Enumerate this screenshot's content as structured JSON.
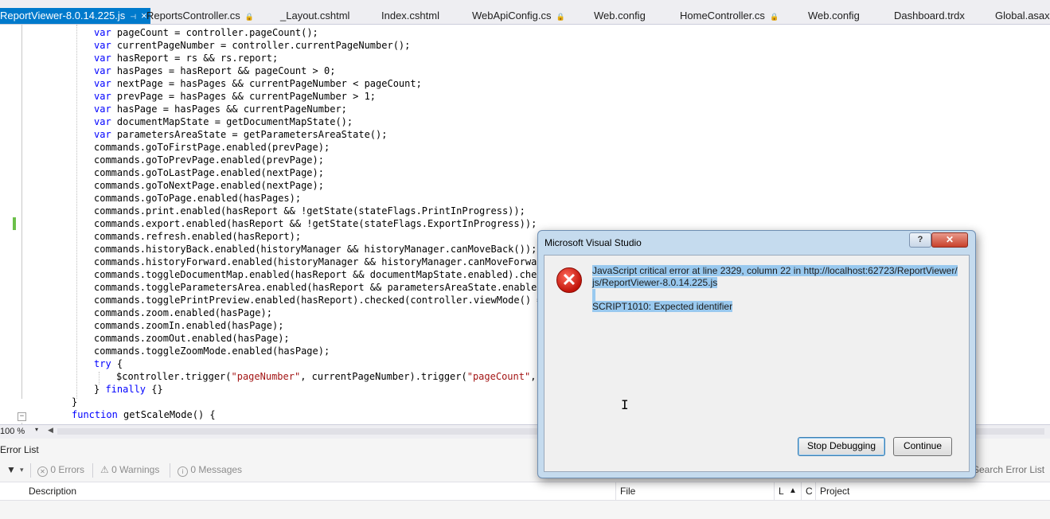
{
  "tabs": [
    {
      "label": "ReportViewer-8.0.14.225.js",
      "glyph": "⊣",
      "close": "×",
      "active": true
    },
    {
      "label": "ReportsController.cs",
      "glyph": "🔒",
      "active": false
    },
    {
      "label": "_Layout.cshtml",
      "active": false
    },
    {
      "label": "Index.cshtml",
      "active": false
    },
    {
      "label": "WebApiConfig.cs",
      "glyph": "🔒",
      "active": false
    },
    {
      "label": "Web.config",
      "active": false
    },
    {
      "label": "HomeController.cs",
      "glyph": "🔒",
      "active": false
    },
    {
      "label": "Web.config",
      "active": false
    },
    {
      "label": "Dashboard.trdx",
      "active": false
    },
    {
      "label": "Global.asax.c",
      "active": false
    }
  ],
  "code": {
    "lines": [
      "var pageCount = controller.pageCount();",
      "var currentPageNumber = controller.currentPageNumber();",
      "var hasReport = rs && rs.report;",
      "var hasPages = hasReport && pageCount > 0;",
      "var nextPage = hasPages && currentPageNumber < pageCount;",
      "var prevPage = hasPages && currentPageNumber > 1;",
      "var hasPage = hasPages && currentPageNumber;",
      "var documentMapState = getDocumentMapState();",
      "var parametersAreaState = getParametersAreaState();",
      "commands.goToFirstPage.enabled(prevPage);",
      "commands.goToPrevPage.enabled(prevPage);",
      "commands.goToLastPage.enabled(nextPage);",
      "commands.goToNextPage.enabled(nextPage);",
      "commands.goToPage.enabled(hasPages);",
      "commands.print.enabled(hasReport && !getState(stateFlags.PrintInProgress));",
      "commands.export.enabled(hasReport && !getState(stateFlags.ExportInProgress));",
      "commands.refresh.enabled(hasReport);",
      "commands.historyBack.enabled(historyManager && historyManager.canMoveBack());",
      "commands.historyForward.enabled(historyManager && historyManager.canMoveForward(",
      "commands.toggleDocumentMap.enabled(hasReport && documentMapState.enabled).checke",
      "commands.toggleParametersArea.enabled(hasReport && parametersAreaState.enabled).",
      "commands.togglePrintPreview.enabled(hasReport).checked(controller.viewMode() ==",
      "commands.zoom.enabled(hasPage);",
      "commands.zoomIn.enabled(hasPage);",
      "commands.zoomOut.enabled(hasPage);",
      "commands.toggleZoomMode.enabled(hasPage);",
      "try {",
      "$controller.trigger(\"pageNumber\", currentPageNumber).trigger(\"pageCount\", pa",
      "} finally {}",
      "}",
      "function getScaleMode() {"
    ],
    "fold_minus": "−"
  },
  "zoom": {
    "level": "100 %",
    "dropdown": "▾",
    "scroll_left": "◀"
  },
  "error_list": {
    "title": "Error List",
    "filter_icon": "▼",
    "filter_drop": "▾",
    "errors": "0 Errors",
    "warnings": "0 Warnings",
    "messages": "0 Messages",
    "search_placeholder": "Search Error List",
    "columns": {
      "description": "Description",
      "file": "File",
      "line": "L",
      "sort": "▲",
      "column": "C",
      "project": "Project"
    }
  },
  "dialog": {
    "title": "Microsoft Visual Studio",
    "help": "?",
    "close": "✕",
    "icon": "✕",
    "message_line1": "JavaScript critical error at line 2329, column 22 in http://localhost:62723/ReportViewer/",
    "message_line2": "js/ReportViewer-8.0.14.225.js",
    "message_line3": "SCRIPT1010: Expected identifier",
    "stop_button": "Stop Debugging",
    "continue_button": "Continue",
    "cursor": "I"
  }
}
